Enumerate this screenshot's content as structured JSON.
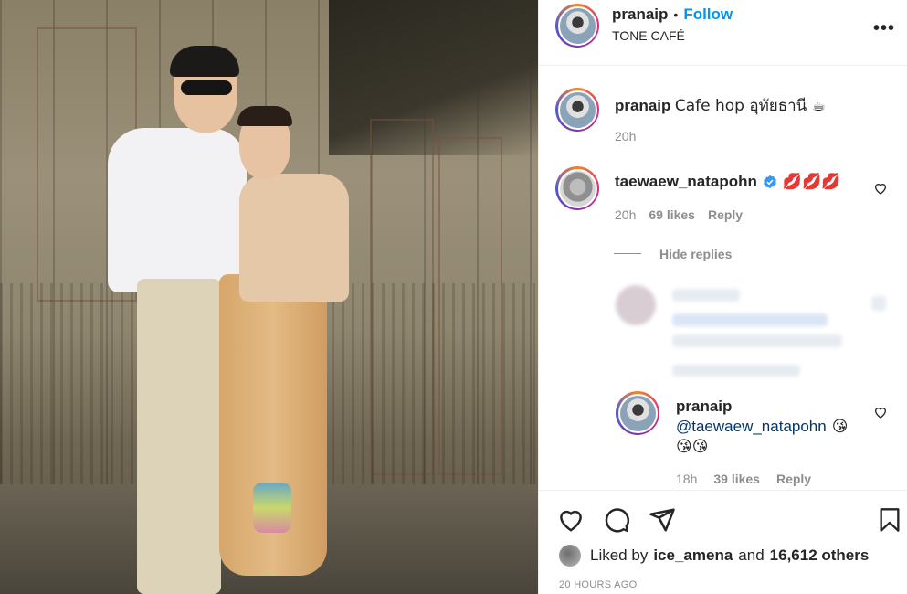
{
  "post": {
    "author": "pranaip",
    "follow_label": "Follow",
    "location": "TONE CAFÉ",
    "more_label": "•••"
  },
  "caption": {
    "author": "pranaip",
    "text": "Cafe hop อุทัยธานี ☕",
    "time": "20h"
  },
  "comments": [
    {
      "author": "taewaew_natapohn",
      "verified": true,
      "text": "💋💋💋",
      "time": "20h",
      "likes": "69 likes",
      "reply_label": "Reply",
      "hide_replies_label": "Hide replies"
    }
  ],
  "replies": [
    {
      "author": "pranaip",
      "mention": "@taewaew_natapohn",
      "text_line1": "😘",
      "text_line2": "😘😘",
      "time": "18h",
      "likes": "39 likes",
      "reply_label": "Reply"
    }
  ],
  "likes": {
    "prefix": "Liked by",
    "user": "ice_amena",
    "middle": "and",
    "others": "16,612 others"
  },
  "timestamp": "20 HOURS AGO",
  "icons": {
    "like": "heart-icon",
    "comment": "comment-icon",
    "share": "share-icon",
    "save": "bookmark-icon",
    "verified": "verified-badge-icon"
  },
  "colors": {
    "accent": "#0095f6",
    "verified": "#3897f0",
    "text": "#262626",
    "muted": "#8e8e8e"
  }
}
